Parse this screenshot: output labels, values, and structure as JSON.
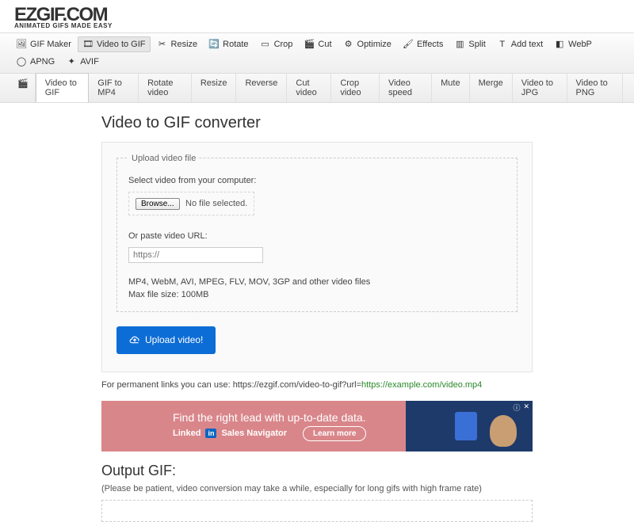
{
  "logo": {
    "top": "EZGIF.COM",
    "sub": "ANIMATED GIFS MADE EASY"
  },
  "main_nav": [
    {
      "label": "GIF Maker",
      "icon": "🖼",
      "active": false
    },
    {
      "label": "Video to GIF",
      "icon": "🎞",
      "active": true
    },
    {
      "label": "Resize",
      "icon": "✂",
      "active": false
    },
    {
      "label": "Rotate",
      "icon": "🔄",
      "active": false
    },
    {
      "label": "Crop",
      "icon": "▭",
      "active": false
    },
    {
      "label": "Cut",
      "icon": "🎬",
      "active": false
    },
    {
      "label": "Optimize",
      "icon": "⚙",
      "active": false
    },
    {
      "label": "Effects",
      "icon": "🖌",
      "active": false
    },
    {
      "label": "Split",
      "icon": "▥",
      "active": false
    },
    {
      "label": "Add text",
      "icon": "T",
      "active": false
    },
    {
      "label": "WebP",
      "icon": "◧",
      "active": false
    },
    {
      "label": "APNG",
      "icon": "◯",
      "active": false
    },
    {
      "label": "AVIF",
      "icon": "✦",
      "active": false
    }
  ],
  "sub_nav": [
    {
      "label": "",
      "icon": "🎬",
      "active": false
    },
    {
      "label": "Video to GIF",
      "active": true
    },
    {
      "label": "GIF to MP4",
      "active": false
    },
    {
      "label": "Rotate video",
      "active": false
    },
    {
      "label": "Resize",
      "active": false
    },
    {
      "label": "Reverse",
      "active": false
    },
    {
      "label": "Cut video",
      "active": false
    },
    {
      "label": "Crop video",
      "active": false
    },
    {
      "label": "Video speed",
      "active": false
    },
    {
      "label": "Mute",
      "active": false
    },
    {
      "label": "Merge",
      "active": false
    },
    {
      "label": "Video to JPG",
      "active": false
    },
    {
      "label": "Video to PNG",
      "active": false
    }
  ],
  "page": {
    "title": "Video to GIF converter",
    "fieldset_legend": "Upload video file",
    "select_label": "Select video from your computer:",
    "browse_label": "Browse...",
    "no_file": "No file selected.",
    "url_label": "Or paste video URL:",
    "url_placeholder": "https://",
    "formats": "MP4, WebM, AVI, MPEG, FLV, MOV, 3GP and other video files",
    "max_size": "Max file size: 100MB",
    "upload_btn": "Upload video!",
    "permalink_text": "For permanent links you can use: https://ezgif.com/video-to-gif?url=",
    "permalink_example": "https://example.com/video.mp4",
    "output_heading": "Output GIF:",
    "output_note": "(Please be patient, video conversion may take a while, especially for long gifs with high frame rate)"
  },
  "ad": {
    "title": "Find the right lead with up-to-date data.",
    "brand": "Linked",
    "brand_suffix": "Sales Navigator",
    "cta": "Learn more",
    "close": "✕",
    "info": "ⓘ"
  }
}
